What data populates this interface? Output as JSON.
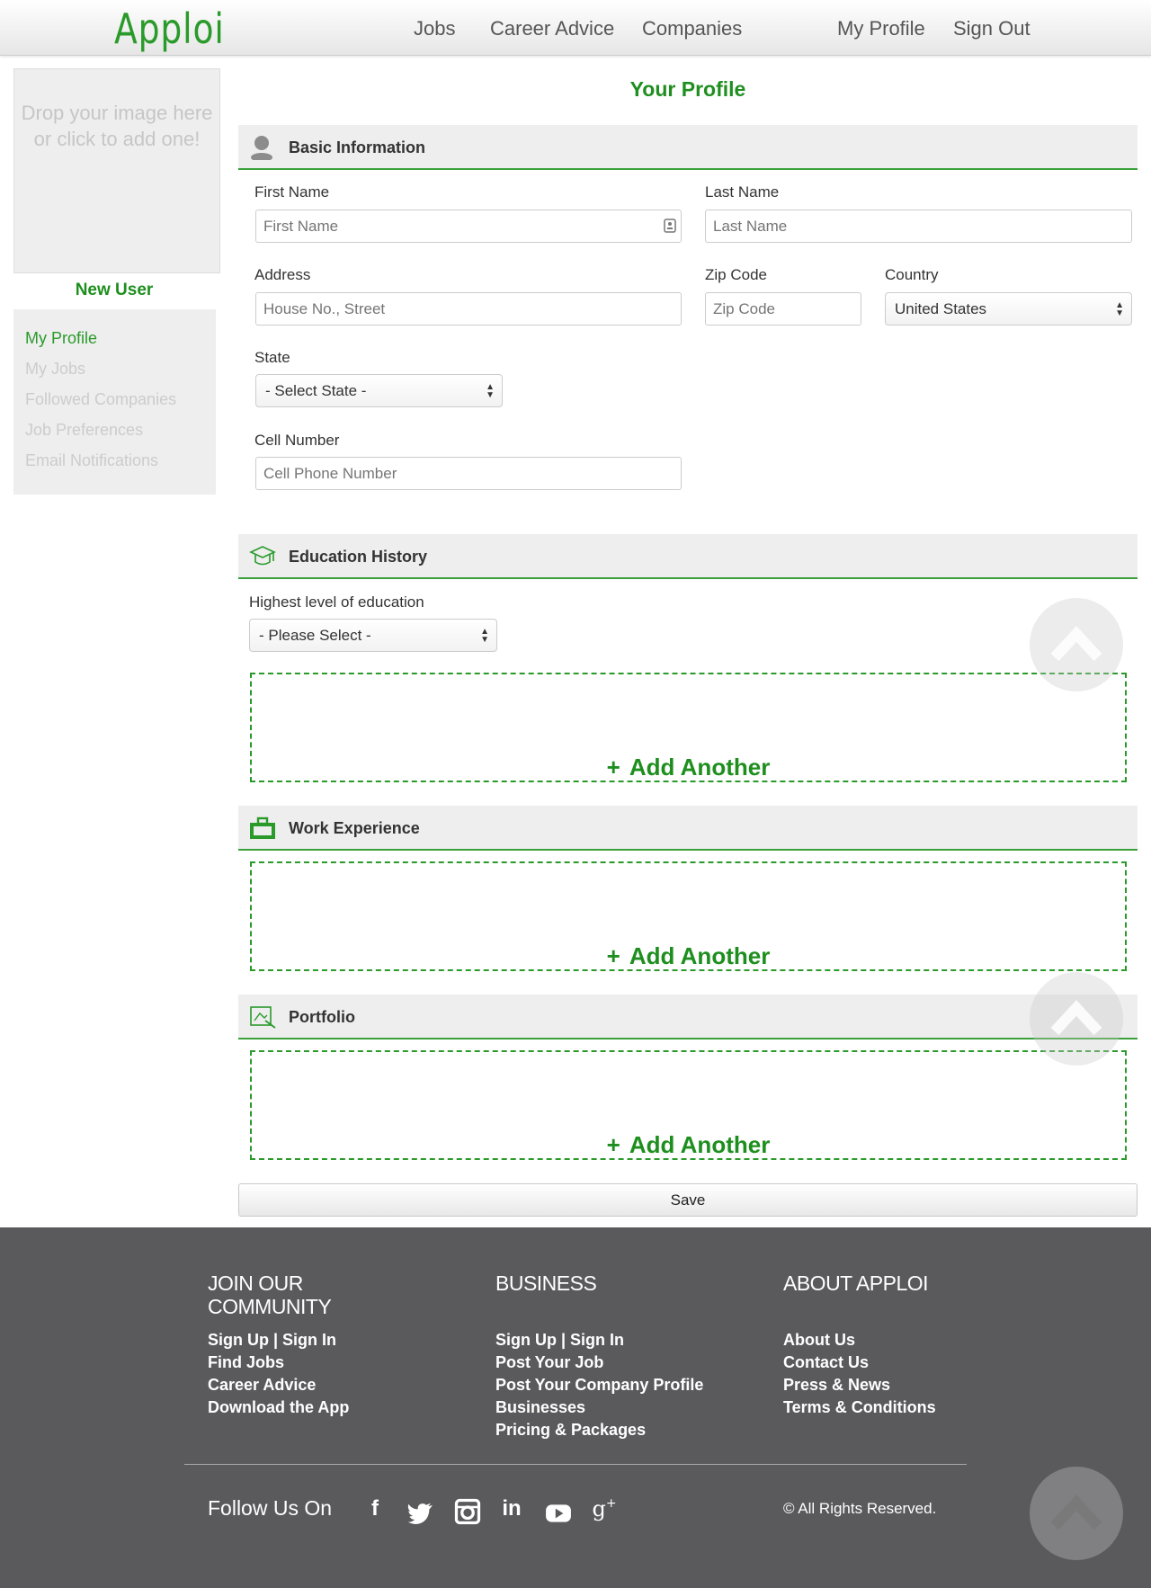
{
  "header": {
    "logo": "Apploi",
    "nav": [
      "Jobs",
      "Career Advice",
      "Companies",
      "My Profile",
      "Sign Out"
    ]
  },
  "sidebar": {
    "dropzone": "Drop your image here or click to add one!",
    "user_name": "New User",
    "menu": [
      {
        "label": "My Profile",
        "active": true
      },
      {
        "label": "My Jobs",
        "active": false
      },
      {
        "label": "Followed Companies",
        "active": false
      },
      {
        "label": "Job Preferences",
        "active": false
      },
      {
        "label": "Email Notifications",
        "active": false
      }
    ]
  },
  "main": {
    "title": "Your Profile",
    "basic": {
      "title": "Basic Information",
      "first_name_label": "First Name",
      "first_name_placeholder": "First Name",
      "last_name_label": "Last Name",
      "last_name_placeholder": "Last Name",
      "address_label": "Address",
      "address_placeholder": "House No., Street",
      "zip_label": "Zip Code",
      "zip_placeholder": "Zip Code",
      "country_label": "Country",
      "country_value": "United States",
      "state_label": "State",
      "state_value": "- Select State -",
      "cell_label": "Cell Number",
      "cell_placeholder": "Cell Phone Number"
    },
    "education": {
      "title": "Education History",
      "level_label": "Highest level of education",
      "level_value": "- Please Select -",
      "add_label": "Add Another"
    },
    "work": {
      "title": "Work Experience",
      "add_label": "Add Another"
    },
    "portfolio": {
      "title": "Portfolio",
      "add_label": "Add Another"
    },
    "save_label": "Save"
  },
  "footer": {
    "community": {
      "title": "JOIN OUR COMMUNITY",
      "signup": "Sign Up",
      "signin": "Sign In",
      "links": [
        "Find Jobs",
        "Career Advice",
        "Download the App"
      ]
    },
    "business": {
      "title": "BUSINESS",
      "signup": "Sign Up",
      "signin": "Sign In",
      "links": [
        "Post Your Job",
        "Post Your Company Profile",
        "Businesses",
        "Pricing & Packages"
      ]
    },
    "about": {
      "title": "ABOUT APPLOI",
      "links": [
        "About Us",
        "Contact Us",
        "Press & News",
        "Terms & Conditions"
      ]
    },
    "follow_label": "Follow Us On",
    "social_icons": [
      "facebook-icon",
      "twitter-icon",
      "instagram-icon",
      "linkedin-icon",
      "youtube-icon",
      "google-plus-icon"
    ],
    "copyright": "© All Rights Reserved."
  },
  "colors": {
    "accent": "#2a9a2a",
    "footer_bg": "#5a595c"
  }
}
